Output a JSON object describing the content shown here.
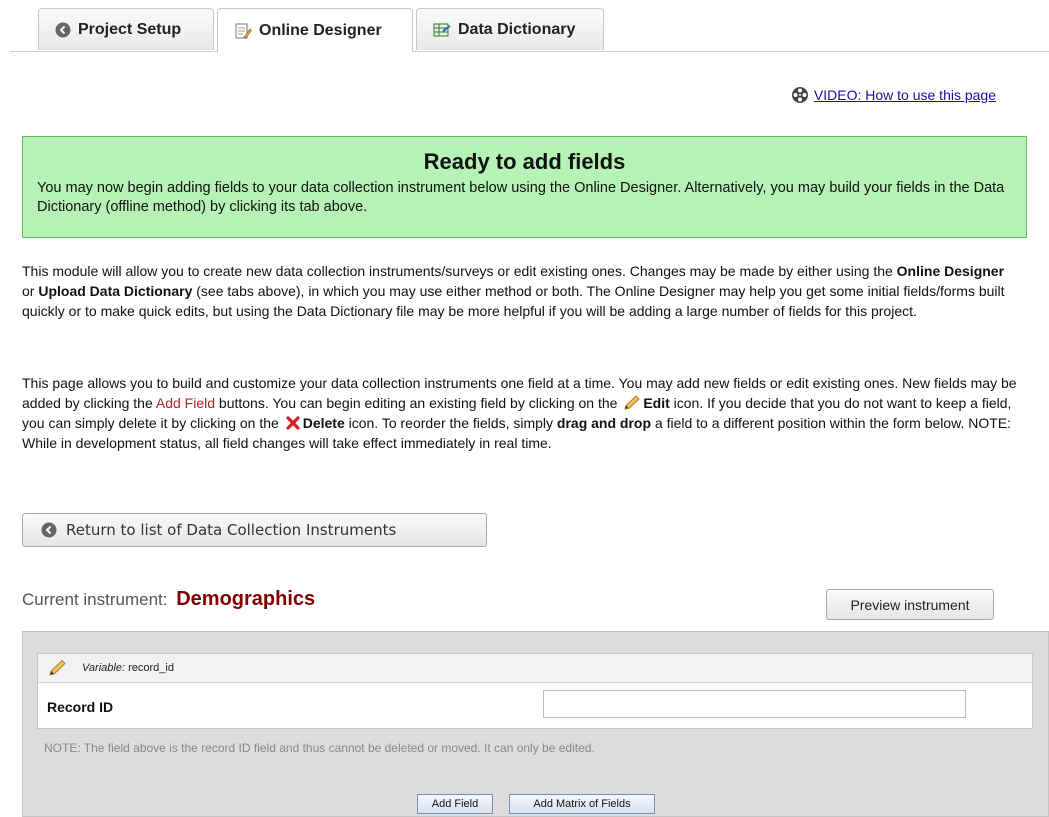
{
  "tabs": [
    {
      "label": "Project Setup",
      "icon": "back-circle-icon"
    },
    {
      "label": "Online Designer",
      "icon": "form-edit-icon"
    },
    {
      "label": "Data Dictionary",
      "icon": "spreadsheet-icon"
    }
  ],
  "video_link": "VIDEO: How to use this page",
  "ready_box": {
    "title": "Ready to add fields",
    "text": "You may now begin adding fields to your data collection instrument below using the Online Designer. Alternatively, you may build your fields in the Data Dictionary (offline method) by clicking its tab above."
  },
  "para1": {
    "t1": "This module will allow you to create new data collection instruments/surveys or edit existing ones. Changes may be made by either using the ",
    "b1": "Online Designer",
    "t2": " or ",
    "b2": "Upload Data Dictionary",
    "t3": " (see tabs above), in which you may use either method or both. The Online Designer may help you get some initial fields/forms built quickly or to make quick edits, but using the Data Dictionary file may be more helpful if you will be adding a large number of fields for this project."
  },
  "para2": {
    "t1": "This page allows you to build and customize your data collection instruments one field at a time. You may add new fields or edit existing ones. New fields may be added by clicking the ",
    "red": "Add Field",
    "t2": " buttons. You can begin editing an existing field by clicking on the ",
    "edit": "Edit",
    "t3": " icon. If you decide that you do not want to keep a field, you can simply delete it by clicking on the ",
    "delete": "Delete",
    "t4": " icon. To reorder the fields, simply ",
    "drag": "drag and drop",
    "t5": " a field to a different position within the form below. NOTE: While in development status, all field changes will take effect immediately in real time."
  },
  "return_button": "Return to list of Data Collection Instruments",
  "current_instrument": {
    "label": "Current instrument:",
    "name": "Demographics"
  },
  "preview_button": "Preview instrument",
  "field": {
    "variable_label": "Variable:",
    "variable_name": "record_id",
    "label": "Record ID",
    "value": ""
  },
  "note": "NOTE: The field above is the record ID field and thus cannot be deleted or moved. It can only be edited.",
  "add_field_button": "Add Field",
  "add_matrix_button": "Add Matrix of Fields",
  "colors": {
    "ready_bg": "#b6f2b6",
    "ready_border": "#5fc45f",
    "instrument_name": "#800000",
    "add_field_text": "#a52a2a"
  }
}
